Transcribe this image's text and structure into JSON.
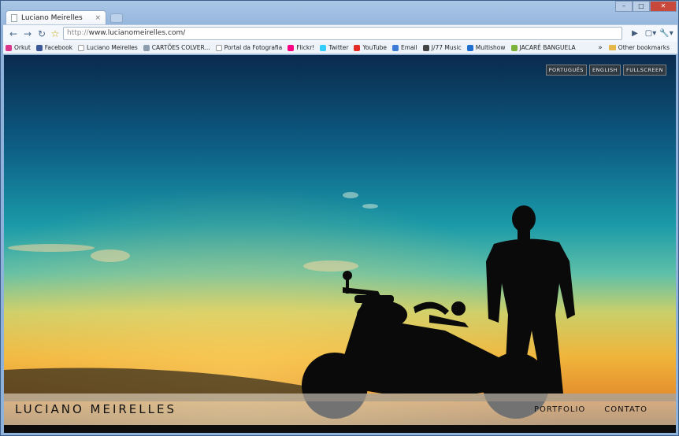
{
  "browser": {
    "tab_title": "Luciano Meirelles",
    "tab_close": "×",
    "window_buttons": {
      "minimize": "–",
      "maximize": "□",
      "close": "✕"
    },
    "url_protocol": "http://",
    "url_rest": "www.lucianomeirelles.com/",
    "nav": {
      "back": "←",
      "forward": "→",
      "reload": "↻",
      "star": "☆",
      "go": "▶",
      "page_menu": "▢▾",
      "wrench": "🔧▾"
    }
  },
  "bookmarks": [
    {
      "label": "Orkut",
      "icon": "orkut-icon",
      "color": "#d9368b"
    },
    {
      "label": "Facebook",
      "icon": "facebook-icon",
      "color": "#3b5998"
    },
    {
      "label": "Luciano Meirelles",
      "icon": "page-icon",
      "color": "#ffffff"
    },
    {
      "label": "CARTÕES COLVER...",
      "icon": "site-icon",
      "color": "#8d9caf"
    },
    {
      "label": "Portal da Fotografia",
      "icon": "page-icon",
      "color": "#ffffff"
    },
    {
      "label": "Flickr!",
      "icon": "flickr-icon",
      "color": "#ff0084"
    },
    {
      "label": "Twitter",
      "icon": "twitter-icon",
      "color": "#33ccff"
    },
    {
      "label": "YouTube",
      "icon": "youtube-icon",
      "color": "#e52d27"
    },
    {
      "label": "Email",
      "icon": "email-icon",
      "color": "#3c7bd6"
    },
    {
      "label": "J/77 Music",
      "icon": "music-icon",
      "color": "#444444"
    },
    {
      "label": "Multishow",
      "icon": "multishow-icon",
      "color": "#1f6fd1"
    },
    {
      "label": "JACARÉ BANGUELA",
      "icon": "jacare-icon",
      "color": "#7bb33a"
    }
  ],
  "bookmarks_overflow": "»",
  "other_bookmarks": "Other bookmarks",
  "site": {
    "languages": [
      "Português",
      "English",
      "Fullscreen"
    ],
    "logo": "LUCIANO MEIRELLES",
    "nav": [
      "PORTFOLIO",
      "CONTATO"
    ]
  }
}
